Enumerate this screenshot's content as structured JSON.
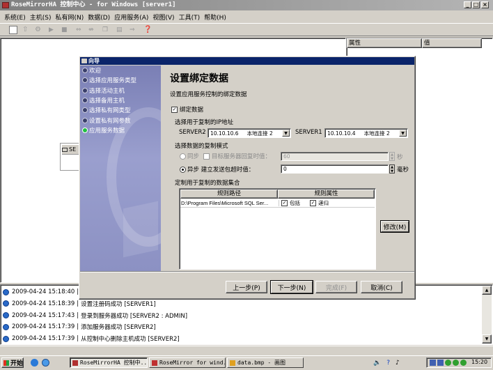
{
  "window": {
    "title": "RoseMirrorHA 控制中心 - for Windows [server1]"
  },
  "menu": [
    "系统(E)",
    "主机(S)",
    "私有网(N)",
    "数据(D)",
    "应用服务(A)",
    "视图(V)",
    "工具(T)",
    "帮助(H)"
  ],
  "toolbar": {
    "icons": [
      "new-icon",
      "up-icon",
      "settings-icon",
      "play-icon",
      "stop-icon",
      "link-icon",
      "unlink-icon",
      "copy-icon",
      "report-icon",
      "export-icon",
      "help-icon"
    ]
  },
  "props": {
    "col_attr": "属性",
    "col_value": "值"
  },
  "server_node": {
    "label": "SE"
  },
  "dialog": {
    "title": "向导",
    "sidebar": [
      "欢迎",
      "选择应用服务类型",
      "选择活动主机",
      "选择备用主机",
      "选择私有网类型",
      "设置私有网参数",
      "应用服务数据"
    ],
    "heading": "设置绑定数据",
    "subtitle": "设置应用服务控制的绑定数据",
    "bind_data_label": "绑定数据",
    "ip_section_label": "选择用于复制的IP地址",
    "server2_label": "SERVER2",
    "server2_ip": "10.10.10.6",
    "server2_conn": "本地连接 2",
    "server1_label": "SERVER1",
    "server1_ip": "10.10.10.4",
    "server1_conn": "本地连接 2",
    "mode_section_label": "选择数据的复制模式",
    "sync_label": "同步",
    "target_lost_label": "目标服务器回复时值：",
    "sync_value": "60",
    "sync_unit": "秒",
    "async_label": "异步 建立发送包超时值：",
    "async_value": "0",
    "async_unit": "毫秒",
    "dataset_label": "定制用于复制的数据集合",
    "table_headers": [
      "规则路径",
      "规则属性"
    ],
    "table_rows": [
      {
        "path": "D:\\Program Files\\Microsoft SQL Ser...",
        "include": "包括",
        "recursive": "递归"
      }
    ],
    "modify_button": "修改(M)",
    "prev_button": "上一步(P)",
    "next_button": "下一步(N)",
    "finish_button": "完成(F)",
    "cancel_button": "取消(C)"
  },
  "log": [
    {
      "time": "2009-04-24 15:18:40",
      "msg": "设"
    },
    {
      "time": "2009-04-24 15:18:39",
      "msg": "设置注册码成功 [SERVER1]"
    },
    {
      "time": "2009-04-24 15:17:43",
      "msg": "登录到服务器成功 [SERVER2 : ADMIN]"
    },
    {
      "time": "2009-04-24 15:17:39",
      "msg": "添加服务器成功 [SERVER2]"
    },
    {
      "time": "2009-04-24 15:17:39",
      "msg": "从控制中心删除主机成功 [SERVER2]"
    }
  ],
  "taskbar": {
    "start_label": "开始",
    "tasks": [
      "RoseMirrorHA 控制中...",
      "RoseMirror for wind...",
      "data.bmp - 画图"
    ],
    "clock": "15:20"
  },
  "colors": {
    "dialog_title": "#0a246a",
    "sidebar_bg": "#7b80b6",
    "selected_item": "#ffffff"
  }
}
